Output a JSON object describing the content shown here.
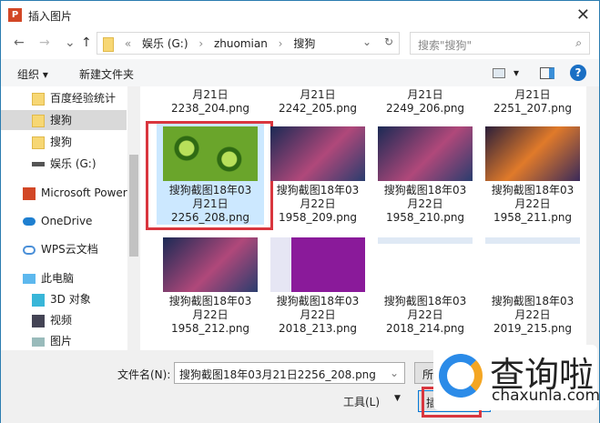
{
  "window": {
    "title": "插入图片",
    "close": "✕"
  },
  "nav": {
    "back": "←",
    "forward": "→",
    "recent": "⌄",
    "up": "↑",
    "crumbs": [
      "«",
      "娱乐 (G:)",
      "›",
      "zhuomian",
      "›",
      "搜狗"
    ],
    "dropdown": "⌄",
    "refresh": "↻"
  },
  "search": {
    "placeholder": "搜索\"搜狗\"",
    "icon": "search-icon"
  },
  "toolbar": {
    "organize": "组织 ▾",
    "new_folder": "新建文件夹",
    "view": "▾",
    "help": "?"
  },
  "sidebar": {
    "items": [
      {
        "label": "百度经验统计",
        "icon": "folder"
      },
      {
        "label": "搜狗",
        "icon": "folder",
        "selected": true
      },
      {
        "label": "搜狗",
        "icon": "folder"
      },
      {
        "label": "娱乐 (G:)",
        "icon": "drive"
      },
      {
        "label": "Microsoft Power",
        "icon": "powerpoint"
      },
      {
        "label": "OneDrive",
        "icon": "cloud"
      },
      {
        "label": "WPS云文档",
        "icon": "cloud-outline"
      },
      {
        "label": "此电脑",
        "icon": "computer"
      },
      {
        "label": "3D 对象",
        "icon": "cube"
      },
      {
        "label": "视频",
        "icon": "film"
      },
      {
        "label": "图片",
        "icon": "picture"
      }
    ]
  },
  "files": {
    "top_partial": [
      [
        "月21日",
        "2238_204.png"
      ],
      [
        "月21日",
        "2242_205.png"
      ],
      [
        "月21日",
        "2249_206.png"
      ],
      [
        "月21日",
        "2251_207.png"
      ]
    ],
    "rows": [
      [
        {
          "l1": "搜狗截图18年03",
          "l2": "月21日",
          "l3": "2256_208.png",
          "thumb": "kiwi",
          "selected": true
        },
        {
          "l1": "搜狗截图18年03",
          "l2": "月22日",
          "l3": "1958_209.png",
          "thumb": "game"
        },
        {
          "l1": "搜狗截图18年03",
          "l2": "月22日",
          "l3": "1958_210.png",
          "thumb": "game"
        },
        {
          "l1": "搜狗截图18年03",
          "l2": "月22日",
          "l3": "1958_211.png",
          "thumb": "game-fire"
        }
      ],
      [
        {
          "l1": "搜狗截图18年03",
          "l2": "月22日",
          "l3": "1958_212.png",
          "thumb": "game"
        },
        {
          "l1": "搜狗截图18年03",
          "l2": "月22日",
          "l3": "2018_213.png",
          "thumb": "purple"
        },
        {
          "l1": "搜狗截图18年03",
          "l2": "月22日",
          "l3": "2018_214.png",
          "thumb": "window"
        },
        {
          "l1": "搜狗截图18年03",
          "l2": "月22日",
          "l3": "2019_215.png",
          "thumb": "window"
        }
      ]
    ]
  },
  "bottom": {
    "filename_label": "文件名(N):",
    "filename": "搜狗截图18年03月21日2256_208.png",
    "filter": "所有",
    "tools": "工具(L)",
    "insert": "插入",
    "cancel": ""
  },
  "watermark": {
    "text": "查询啦",
    "url": "chaxunla.com"
  },
  "colors": {
    "selection": "#cce8ff",
    "highlight": "#d9363e",
    "accent": "#1a6fc4"
  }
}
